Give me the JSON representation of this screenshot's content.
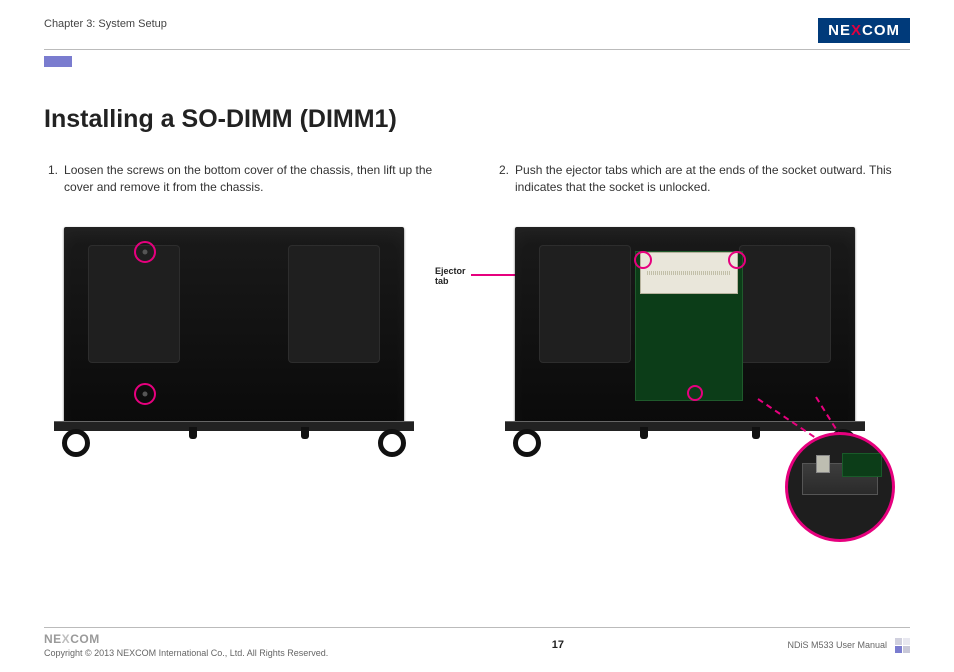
{
  "header": {
    "chapter": "Chapter 3: System Setup",
    "brand": {
      "pre": "NE",
      "mid": "X",
      "post": "COM"
    }
  },
  "title": "Installing a SO-DIMM (DIMM1)",
  "steps": {
    "s1_num": "1.",
    "s1_text": "Loosen the screws on the bottom cover of the chassis, then lift up the cover and remove it from the chassis.",
    "s2_num": "2.",
    "s2_text": "Push the ejector tabs which are at the ends of the socket outward. This indicates that the socket is unlocked."
  },
  "labels": {
    "ejector": "Ejector\ntab"
  },
  "footer": {
    "brand": {
      "pre": "NE",
      "mid": "X",
      "post": "COM"
    },
    "copyright": "Copyright © 2013 NEXCOM International Co., Ltd. All Rights Reserved.",
    "page": "17",
    "doc": "NDiS M533 User Manual"
  }
}
